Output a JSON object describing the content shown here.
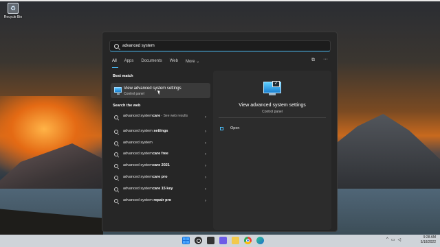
{
  "desktop": {
    "recycle_bin_label": "Recycle Bin"
  },
  "search": {
    "query": "advanced system"
  },
  "filters": [
    {
      "label": "All",
      "active": true
    },
    {
      "label": "Apps"
    },
    {
      "label": "Documents"
    },
    {
      "label": "Web"
    },
    {
      "label": "More ⌄"
    }
  ],
  "best_match": {
    "section_title": "Best match",
    "title": "View advanced system settings",
    "subtitle": "Control panel"
  },
  "web_section_title": "Search the web",
  "web_results": [
    {
      "prefix": "advanced system",
      "bold": "care",
      "sub": " - See web results"
    },
    {
      "prefix": "advanced system ",
      "bold": "settings"
    },
    {
      "prefix": "advanced system",
      "bold": ""
    },
    {
      "prefix": "advanced system",
      "bold": "care free"
    },
    {
      "prefix": "advanced system",
      "bold": "care 2021"
    },
    {
      "prefix": "advanced system",
      "bold": "care pro"
    },
    {
      "prefix": "advanced system",
      "bold": "care 15 key"
    },
    {
      "prefix": "advanced system ",
      "bold": "repair pro"
    }
  ],
  "detail": {
    "title": "View advanced system settings",
    "subtitle": "Control panel",
    "actions": [
      {
        "label": "Open"
      }
    ]
  },
  "taskbar": {
    "time": "9:28 AM",
    "date": "5/18/2022",
    "tray_chevron": "^"
  },
  "icons": {
    "search": "search-icon",
    "chevron": "›"
  }
}
